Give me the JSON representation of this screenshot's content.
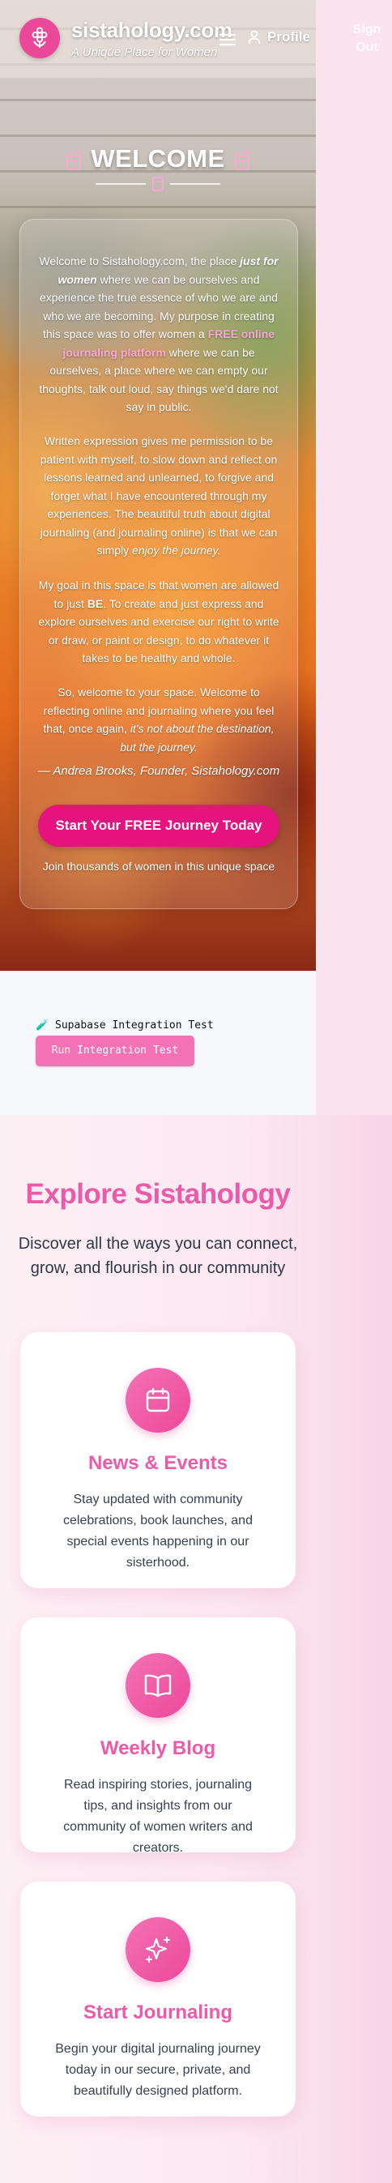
{
  "header": {
    "brand": "sistahology.com",
    "tagline": "A Unique Place for Women",
    "profile_label": "Profile",
    "signout_line1": "Sign",
    "signout_line2": "Out"
  },
  "hero": {
    "title": "WELCOME",
    "p1_a": "Welcome to Sistahology.com, the place ",
    "p1_em": "just for women",
    "p1_b": " where we can be ourselves and experience the true essence of who we are and who we are becoming. My purpose in creating this space was to offer women a ",
    "p1_hl": "FREE online journaling platform",
    "p1_c": " where we can be ourselves, a place where we can empty our thoughts, talk out loud, say things we'd dare not say in public.",
    "p2_a": "Written expression gives me permission to be patient with myself, to slow down and reflect on lessons learned and unlearned, to forgive and forget what I have encountered through my experiences. The beautiful truth about digital journaling (and journaling online) is that we can simply ",
    "p2_em": "enjoy the journey.",
    "p3_a": "My goal in this space is that women are allowed to just ",
    "p3_b": "BE",
    "p3_c": ". To create and just express and explore ourselves and exercise our right to write or draw, or paint or design, to do whatever it takes to be healthy and whole.",
    "p4_a": "So, welcome to your space. Welcome to reflecting online and journaling where you feel that, once again, ",
    "p4_em": "it's not about the destination, but the journey.",
    "signature": "— Andrea Brooks, Founder, Sistahology.com",
    "cta_label": "Start Your FREE Journey Today",
    "cta_sub": "Join thousands of women in this unique space"
  },
  "test": {
    "title": "🧪 Supabase Integration Test",
    "button_label": "Run Integration Test"
  },
  "explore": {
    "title": "Explore Sistahology",
    "subtitle": "Discover all the ways you can connect, grow, and flourish in our community",
    "cards": [
      {
        "icon": "calendar-icon",
        "title": "News & Events",
        "desc": "Stay updated with community celebrations, book launches, and special events happening in our sisterhood."
      },
      {
        "icon": "book-open-icon",
        "title": "Weekly Blog",
        "desc": "Read inspiring stories, journaling tips, and insights from our community of women writers and creators."
      },
      {
        "icon": "sparkles-icon",
        "title": "Start Journaling",
        "desc": "Begin your digital journaling journey today in our secure, private, and beautifully designed platform."
      }
    ]
  },
  "colors": {
    "brand_pink": "#ec4899",
    "cta_pink": "#e6127e",
    "heading_pink": "#ec5aa9",
    "highlight_pink": "#f9a8d4"
  }
}
